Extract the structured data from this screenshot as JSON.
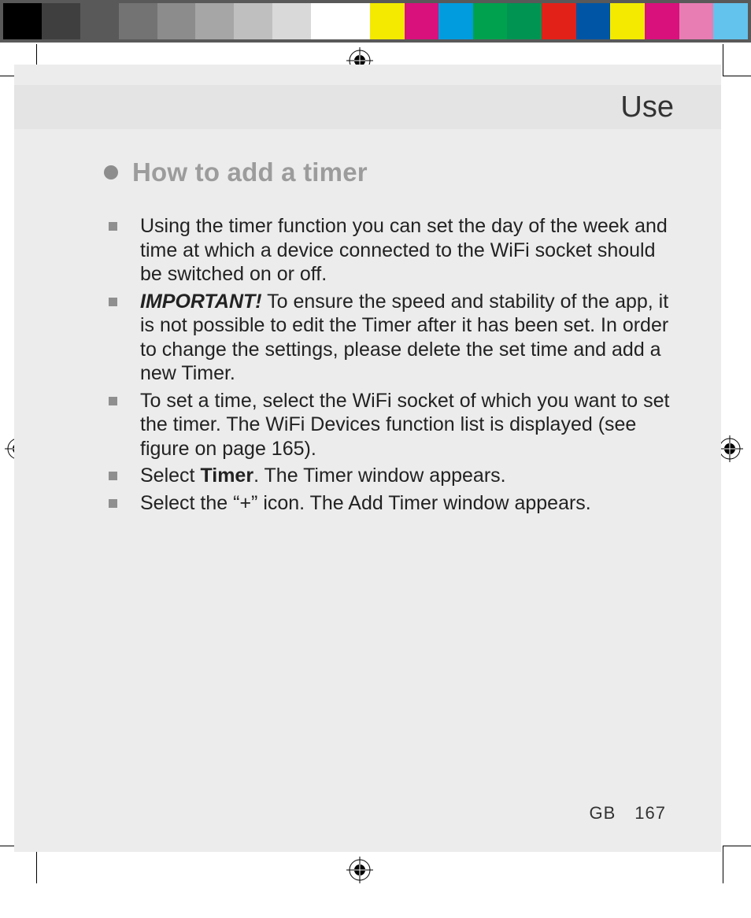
{
  "color_bar": {
    "left": [
      "#000000",
      "#3f3f3f",
      "#595959",
      "#737373",
      "#8c8c8c",
      "#a6a6a6",
      "#bfbfbf",
      "#d9d9d9",
      "#ffffff"
    ],
    "right": [
      "#f3ea00",
      "#d9117c",
      "#009cdd",
      "#00a14e",
      "#009453",
      "#e22119",
      "#0055a4",
      "#f3ea00",
      "#d9117c",
      "#e77db3",
      "#63c3ec"
    ]
  },
  "header": {
    "title": "Use"
  },
  "section": {
    "title": "How to add a timer"
  },
  "items": [
    {
      "text": "Using the timer function you can set the day of the week and time at which a device connected to the WiFi socket should be switched on or off."
    },
    {
      "prefix_bold_italic": "IMPORTANT!",
      "text": " To ensure the speed and stability of the app, it is not possible to edit the Timer after it has been set. In order to change the settings, please delete the set time and add a new Timer."
    },
    {
      "text": "To set a time, select the WiFi socket of which you want to set the timer. The WiFi Devices function list is displayed (see figure on page 165)."
    },
    {
      "pre": "Select ",
      "mid_bold": "Timer",
      "post": ". The Timer window appears."
    },
    {
      "text": "Select the “+” icon. The Add Timer window appears."
    }
  ],
  "footer": {
    "lang": "GB",
    "page": "167"
  }
}
